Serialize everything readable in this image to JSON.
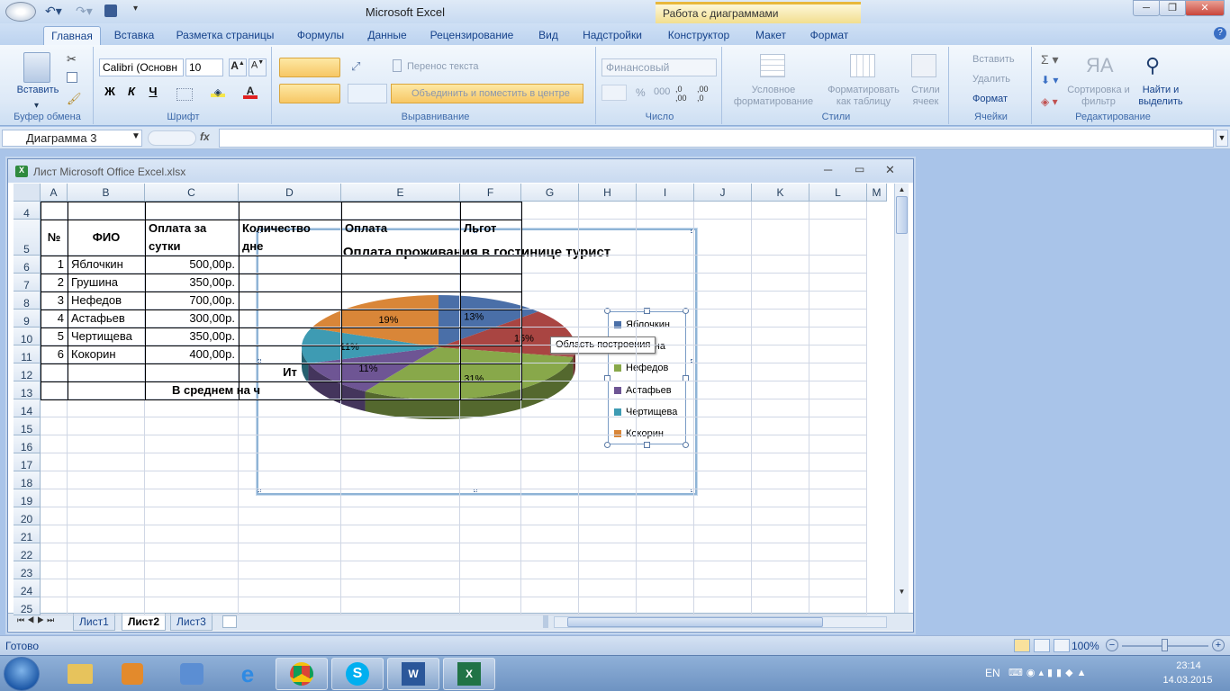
{
  "app": {
    "title": "Microsoft Excel",
    "context_group": "Работа с диаграммами"
  },
  "tabs": [
    "Главная",
    "Вставка",
    "Разметка страницы",
    "Формулы",
    "Данные",
    "Рецензирование",
    "Вид",
    "Надстройки",
    "Конструктор",
    "Макет",
    "Формат"
  ],
  "ribbon": {
    "clipboard": {
      "paste": "Вставить",
      "label": "Буфер обмена"
    },
    "font": {
      "name": "Calibri (Основн",
      "size": "10",
      "bold": "Ж",
      "italic": "К",
      "underline": "Ч",
      "label": "Шрифт"
    },
    "align": {
      "wrap": "Перенос текста",
      "merge": "Объединить и поместить в центре",
      "label": "Выравнивание"
    },
    "number": {
      "format": "Финансовый",
      "percent": "%",
      "thousands": "000",
      "label": "Число"
    },
    "styles": {
      "cond": "Условное форматирование",
      "table": "Форматировать как таблицу",
      "cell": "Стили ячеек",
      "label": "Стили"
    },
    "cells": {
      "insert": "Вставить",
      "delete": "Удалить",
      "format": "Формат",
      "label": "Ячейки"
    },
    "edit": {
      "sort": "Сортировка и фильтр",
      "find": "Найти и выделить",
      "label": "Редактирование"
    }
  },
  "formula": {
    "namebox": "Диаграмма 3",
    "fx": "fx"
  },
  "workbook": {
    "title": "Лист Microsoft Office Excel.xlsx",
    "columns": [
      "A",
      "B",
      "C",
      "D",
      "E",
      "F",
      "G",
      "H",
      "I",
      "J",
      "K",
      "L",
      "M"
    ],
    "row_numbers": [
      "4",
      "5",
      "6",
      "7",
      "8",
      "9",
      "10",
      "11",
      "12",
      "13",
      "14",
      "15",
      "16",
      "17",
      "18",
      "19",
      "20",
      "21",
      "22",
      "23",
      "24",
      "25"
    ],
    "headers": {
      "no": "№",
      "fio": "ФИО",
      "pay1": "Оплата за",
      "pay2": "сутки",
      "qty1": "Количество",
      "qty2": "дне",
      "payE": "Оплата",
      "F": "Льгот"
    },
    "rows": [
      {
        "n": "1",
        "name": "Яблочкин",
        "pay": "500,00р."
      },
      {
        "n": "2",
        "name": "Грушина",
        "pay": "350,00р."
      },
      {
        "n": "3",
        "name": "Нефедов",
        "pay": "700,00р."
      },
      {
        "n": "4",
        "name": "Астафьев",
        "pay": "300,00р."
      },
      {
        "n": "5",
        "name": "Чертищева",
        "pay": "350,00р."
      },
      {
        "n": "6",
        "name": "Кокорин",
        "pay": "400,00р."
      }
    ],
    "row12": "Ит",
    "row13": "В среднем на ч",
    "sheets": [
      "Лист1",
      "Лист2",
      "Лист3"
    ],
    "active_sheet": "Лист2"
  },
  "chart_data": {
    "type": "pie",
    "title": "Оплата проживания в гостинице турист",
    "categories": [
      "Яблочкин",
      "Грушина",
      "Нефедов",
      "Астафьев",
      "Чертищева",
      "Кокорин"
    ],
    "values": [
      13,
      15,
      31,
      11,
      11,
      19
    ],
    "labels": [
      "13%",
      "15%",
      "31%",
      "11%",
      "11%",
      "19%"
    ],
    "colors": [
      "#4a6fa8",
      "#a94542",
      "#88a84a",
      "#6e5594",
      "#3e9bb3",
      "#d98638"
    ],
    "legend_position": "right",
    "3d": true
  },
  "tooltip": "Область построения",
  "status": {
    "ready": "Готово",
    "zoom": "100%"
  },
  "taskbar": {
    "lang": "EN",
    "time": "23:14",
    "date": "14.03.2015"
  }
}
